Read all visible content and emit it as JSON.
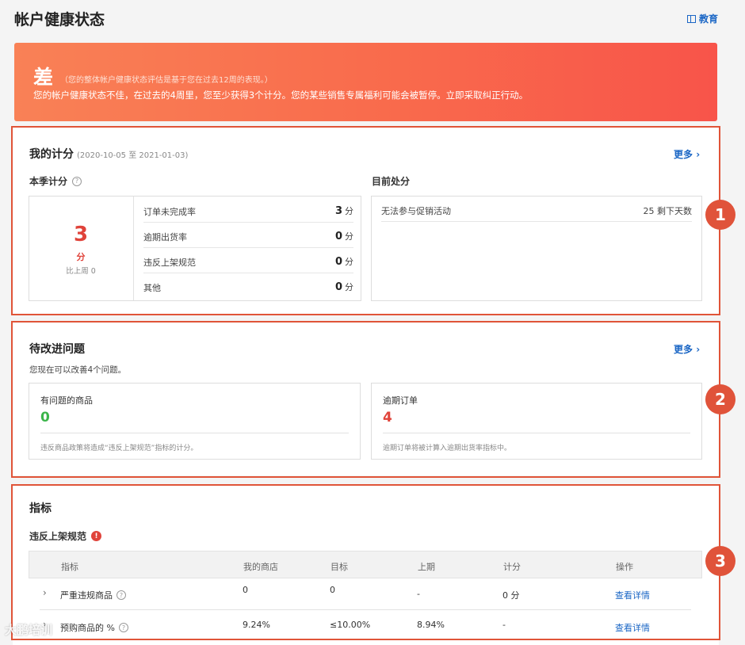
{
  "header": {
    "title": "帐户健康状态",
    "edu_label": "教育"
  },
  "alert": {
    "grade": "差",
    "note": "（您的整体帐户健康状态评估是基于您在过去12周的表现。）",
    "message": "您的帐户健康状态不佳，在过去的4周里，您至少获得3个计分。您的某些销售专属福利可能会被暂停。立即采取纠正行动。"
  },
  "scores": {
    "title": "我的计分",
    "range": "(2020-10-05 至 2021-01-03)",
    "more": "更多",
    "quarter_title": "本季计分",
    "total": "3",
    "total_unit": "分",
    "compare": "比上周 0",
    "metrics": [
      {
        "label": "订单未完成率",
        "value": "3",
        "unit": "分"
      },
      {
        "label": "逾期出货率",
        "value": "0",
        "unit": "分"
      },
      {
        "label": "违反上架规范",
        "value": "0",
        "unit": "分"
      },
      {
        "label": "其他",
        "value": "0",
        "unit": "分"
      }
    ],
    "penalty_title": "目前处分",
    "penalties": [
      {
        "label": "无法参与促销活动",
        "value": "25 剩下天数"
      }
    ]
  },
  "issues": {
    "title": "待改进问题",
    "more": "更多",
    "summary": "您现在可以改善4个问题。",
    "cards": [
      {
        "label": "有问题的商品",
        "count": "0",
        "desc": "违反商品政策将造成“违反上架规范”指标的计分。"
      },
      {
        "label": "逾期订单",
        "count": "4",
        "desc": "逾期订单将被计算入逾期出货率指标中。"
      }
    ]
  },
  "indicators": {
    "title": "指标",
    "section": "违反上架规范",
    "warn": "!",
    "columns": [
      "指标",
      "我的商店",
      "目标",
      "上期",
      "计分",
      "操作"
    ],
    "rows": [
      {
        "name": "严重违规商品",
        "mine": "0",
        "target": "0",
        "prev": "-",
        "score": "0 分",
        "action": "查看详情"
      },
      {
        "name": "预购商品的 %",
        "mine": "9.24%",
        "target": "≤10.00%",
        "prev": "8.94%",
        "score": "-",
        "action": "查看详情"
      }
    ]
  },
  "badges": [
    "1",
    "2",
    "3"
  ],
  "watermark": "大鹏培训",
  "colors": {
    "accent": "#1a66c5",
    "danger": "#e0433a",
    "success": "#3bb54a",
    "outline": "#e05438"
  }
}
